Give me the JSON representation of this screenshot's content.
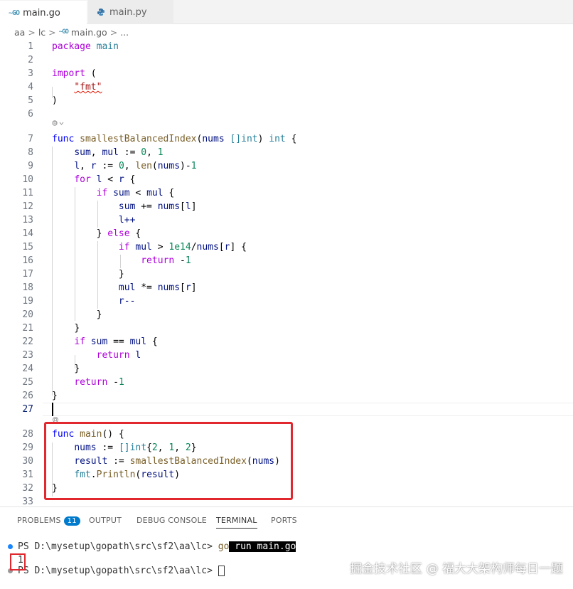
{
  "tabs": [
    {
      "icon": "go-file-icon",
      "icon_glyph": "~GO",
      "label": "main.go",
      "active": true
    },
    {
      "icon": "python-file-icon",
      "label": "main.py",
      "active": false
    }
  ],
  "breadcrumb": [
    "aa",
    "lc",
    "main.go",
    "..."
  ],
  "breadcrumb_sep": ">",
  "editor": {
    "line_numbers": [
      "1",
      "2",
      "3",
      "4",
      "5",
      "6",
      "7",
      "8",
      "9",
      "10",
      "11",
      "12",
      "13",
      "14",
      "15",
      "16",
      "17",
      "18",
      "19",
      "20",
      "21",
      "22",
      "23",
      "24",
      "25",
      "26",
      "27",
      "28",
      "29",
      "30",
      "31",
      "32",
      "33"
    ],
    "code": {
      "l1a": "package",
      "l1b": "main",
      "l3a": "import",
      "l3b": "(",
      "l4": "\"fmt\"",
      "l5": ")",
      "l7a": "func",
      "l7b": "smallestBalancedIndex",
      "l7c": "(",
      "l7d": "nums",
      "l7e": "[]int",
      "l7f": ")",
      "l7g": "int",
      "l7h": "{",
      "l8a": "sum",
      "l8b": ", ",
      "l8c": "mul",
      "l8d": " := ",
      "l8e": "0",
      "l8f": ", ",
      "l8g": "1",
      "l9a": "l",
      "l9b": ", ",
      "l9c": "r",
      "l9d": " := ",
      "l9e": "0",
      "l9f": ", ",
      "l9g": "len",
      "l9h": "(",
      "l9i": "nums",
      "l9j": ")-",
      "l9k": "1",
      "l10a": "for",
      "l10b": "l",
      "l10c": " < ",
      "l10d": "r",
      "l10e": " {",
      "l11a": "if",
      "l11b": "sum",
      "l11c": " < ",
      "l11d": "mul",
      "l11e": " {",
      "l12a": "sum",
      "l12b": " += ",
      "l12c": "nums",
      "l12d": "[",
      "l12e": "l",
      "l12f": "]",
      "l13": "l++",
      "l14a": "} ",
      "l14b": "else",
      "l14c": " {",
      "l15a": "if",
      "l15b": "mul",
      "l15c": " > ",
      "l15d": "1e14",
      "l15e": "/",
      "l15f": "nums",
      "l15g": "[",
      "l15h": "r",
      "l15i": "] {",
      "l16a": "return",
      "l16b": " -",
      "l16c": "1",
      "l17": "}",
      "l18a": "mul",
      "l18b": " *= ",
      "l18c": "nums",
      "l18d": "[",
      "l18e": "r",
      "l18f": "]",
      "l19": "r--",
      "l20": "}",
      "l21": "}",
      "l22a": "if",
      "l22b": "sum",
      "l22c": " == ",
      "l22d": "mul",
      "l22e": " {",
      "l23a": "return",
      "l23b": "l",
      "l24": "}",
      "l25a": "return",
      "l25b": " -",
      "l25c": "1",
      "l26": "}",
      "l28a": "func",
      "l28b": "main",
      "l28c": "() {",
      "l29a": "nums",
      "l29b": " := ",
      "l29c": "[]int",
      "l29d": "{",
      "l29e": "2",
      "l29f": ", ",
      "l29g": "1",
      "l29h": ", ",
      "l29i": "2",
      "l29j": "}",
      "l30a": "result",
      "l30b": " := ",
      "l30c": "smallestBalancedIndex",
      "l30d": "(",
      "l30e": "nums",
      "l30f": ")",
      "l31a": "fmt",
      "l31b": ".",
      "l31c": "Println",
      "l31d": "(",
      "l31e": "result",
      "l31f": ")",
      "l32": "}"
    }
  },
  "panel": {
    "tabs": [
      "PROBLEMS",
      "OUTPUT",
      "DEBUG CONSOLE",
      "TERMINAL",
      "PORTS"
    ],
    "active_tab": "TERMINAL",
    "problems_count": "11",
    "terminal": {
      "prompt1": "D:\\mysetup\\gopath\\src\\sf2\\aa\\lc>",
      "cmd_go": "go",
      "cmd_rest": " run main.go",
      "output": "1",
      "prompt2": "D:\\mysetup\\gopath\\src\\sf2\\aa\\lc>",
      "ps_prefix": "PS"
    }
  },
  "watermark": "掘金技术社区 @ 福大大架构师每日一题",
  "colors": {
    "accent": "#007acc",
    "highlight_box": "#e0282e"
  }
}
